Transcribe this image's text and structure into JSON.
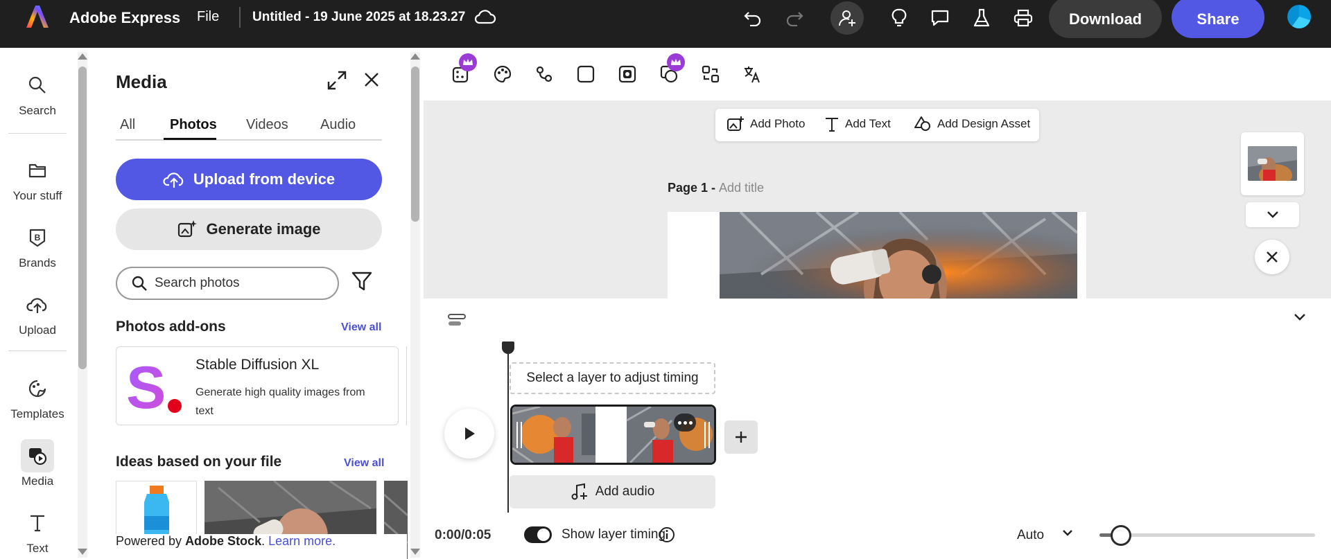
{
  "topbar": {
    "app_name": "Adobe Express",
    "file_menu": "File",
    "doc_title": "Untitled - 19 June 2025 at 18.23.27",
    "download_label": "Download",
    "share_label": "Share",
    "icons": [
      "undo-icon",
      "redo-icon",
      "invite-collaborator-icon",
      "lightbulb-icon",
      "comment-icon",
      "flask-icon",
      "print-icon",
      "cloud-sync-icon"
    ]
  },
  "rail": {
    "items": [
      {
        "label": "Search",
        "icon": "search-icon"
      },
      {
        "label": "Your stuff",
        "icon": "folder-icon"
      },
      {
        "label": "Brands",
        "icon": "brand-icon"
      },
      {
        "label": "Upload",
        "icon": "upload-cloud-icon"
      },
      {
        "label": "Templates",
        "icon": "templates-icon"
      },
      {
        "label": "Media",
        "icon": "media-icon"
      },
      {
        "label": "Text",
        "icon": "text-icon"
      }
    ],
    "active": "Media"
  },
  "panel": {
    "title": "Media",
    "tabs": [
      "All",
      "Photos",
      "Videos",
      "Audio"
    ],
    "active_tab": "Photos",
    "upload_label": "Upload from device",
    "generate_label": "Generate image",
    "search_placeholder": "Search photos",
    "addons_title": "Photos add-ons",
    "addons_viewall": "View all",
    "addon": {
      "logo_letter": "S.",
      "name": "Stable Diffusion XL",
      "desc": "Generate high quality images from text"
    },
    "ideas_title": "Ideas based on your file",
    "ideas_viewall": "View all",
    "powered_prefix": "Powered by ",
    "powered_brand": "Adobe Stock",
    "powered_suffix": ". ",
    "learn_more": "Learn more."
  },
  "canvas": {
    "quick_actions": [
      "Add Photo",
      "Add Text",
      "Add Design Asset"
    ],
    "page_label": "Page 1 - ",
    "page_title_placeholder": "Add title"
  },
  "timeline": {
    "hint": "Select a layer to adjust timing",
    "add_audio": "Add audio",
    "time": "0:00/0:05",
    "show_layer_timing": "Show layer timing",
    "show_layer_timing_on": true,
    "zoom": "Auto",
    "zoom_level": 0.1
  },
  "colors": {
    "accent": "#5258e4",
    "topbar": "#1f1f1f",
    "premium": "#9b3bd6"
  }
}
